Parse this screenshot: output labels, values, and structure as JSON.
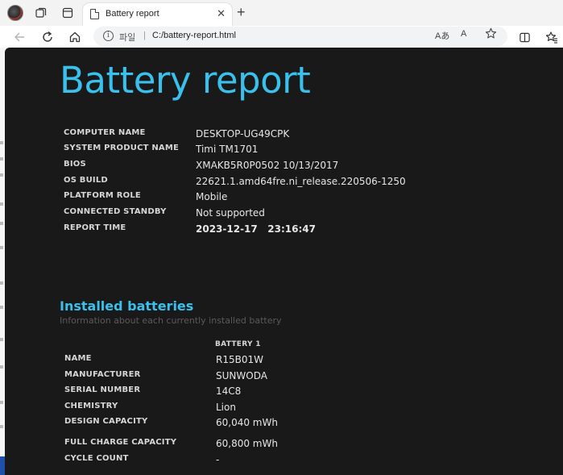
{
  "browser": {
    "tab_title": "Battery report",
    "address": {
      "scheme_label": "파일",
      "separator": "|",
      "url": "C:/battery-report.html",
      "read_aloud_label": "Aあ",
      "immersive_label": "A"
    },
    "icons": [
      "avatar",
      "workspaces-icon",
      "tab-actions-icon",
      "document-icon",
      "close-icon",
      "new-tab-icon",
      "back-icon",
      "refresh-icon",
      "home-icon",
      "info-icon",
      "favorite-star-icon",
      "split-screen-icon",
      "favorites-icon"
    ]
  },
  "report": {
    "title": "Battery report",
    "system_info": [
      {
        "label": "COMPUTER NAME",
        "value": "DESKTOP-UG49CPK"
      },
      {
        "label": "SYSTEM PRODUCT NAME",
        "value": "Timi TM1701"
      },
      {
        "label": "BIOS",
        "value": "XMAKB5R0P0502 10/13/2017"
      },
      {
        "label": "OS BUILD",
        "value": "22621.1.amd64fre.ni_release.220506-1250"
      },
      {
        "label": "PLATFORM ROLE",
        "value": "Mobile"
      },
      {
        "label": "CONNECTED STANDBY",
        "value": "Not supported"
      },
      {
        "label": "REPORT TIME",
        "value": "2023-12-17   23:16:47"
      }
    ],
    "installed_batteries": {
      "title": "Installed batteries",
      "subtitle": "Information about each currently installed battery",
      "column_header": "BATTERY 1",
      "rows": [
        {
          "label": "NAME",
          "value": "R15B01W"
        },
        {
          "label": "MANUFACTURER",
          "value": "SUNWODA"
        },
        {
          "label": "SERIAL NUMBER",
          "value": "14C8"
        },
        {
          "label": "CHEMISTRY",
          "value": "Lion"
        },
        {
          "label": "DESIGN CAPACITY",
          "value": "60,040 mWh"
        },
        {
          "label": "FULL CHARGE CAPACITY",
          "value": "60,800 mWh"
        },
        {
          "label": "CYCLE COUNT",
          "value": "-"
        }
      ]
    }
  },
  "colors": {
    "accent": "#39c0ed",
    "page_background": "#191919",
    "label_text": "#d6d6d6",
    "value_text": "#e6e6e6",
    "subtitle_text": "#5a5a5a"
  }
}
